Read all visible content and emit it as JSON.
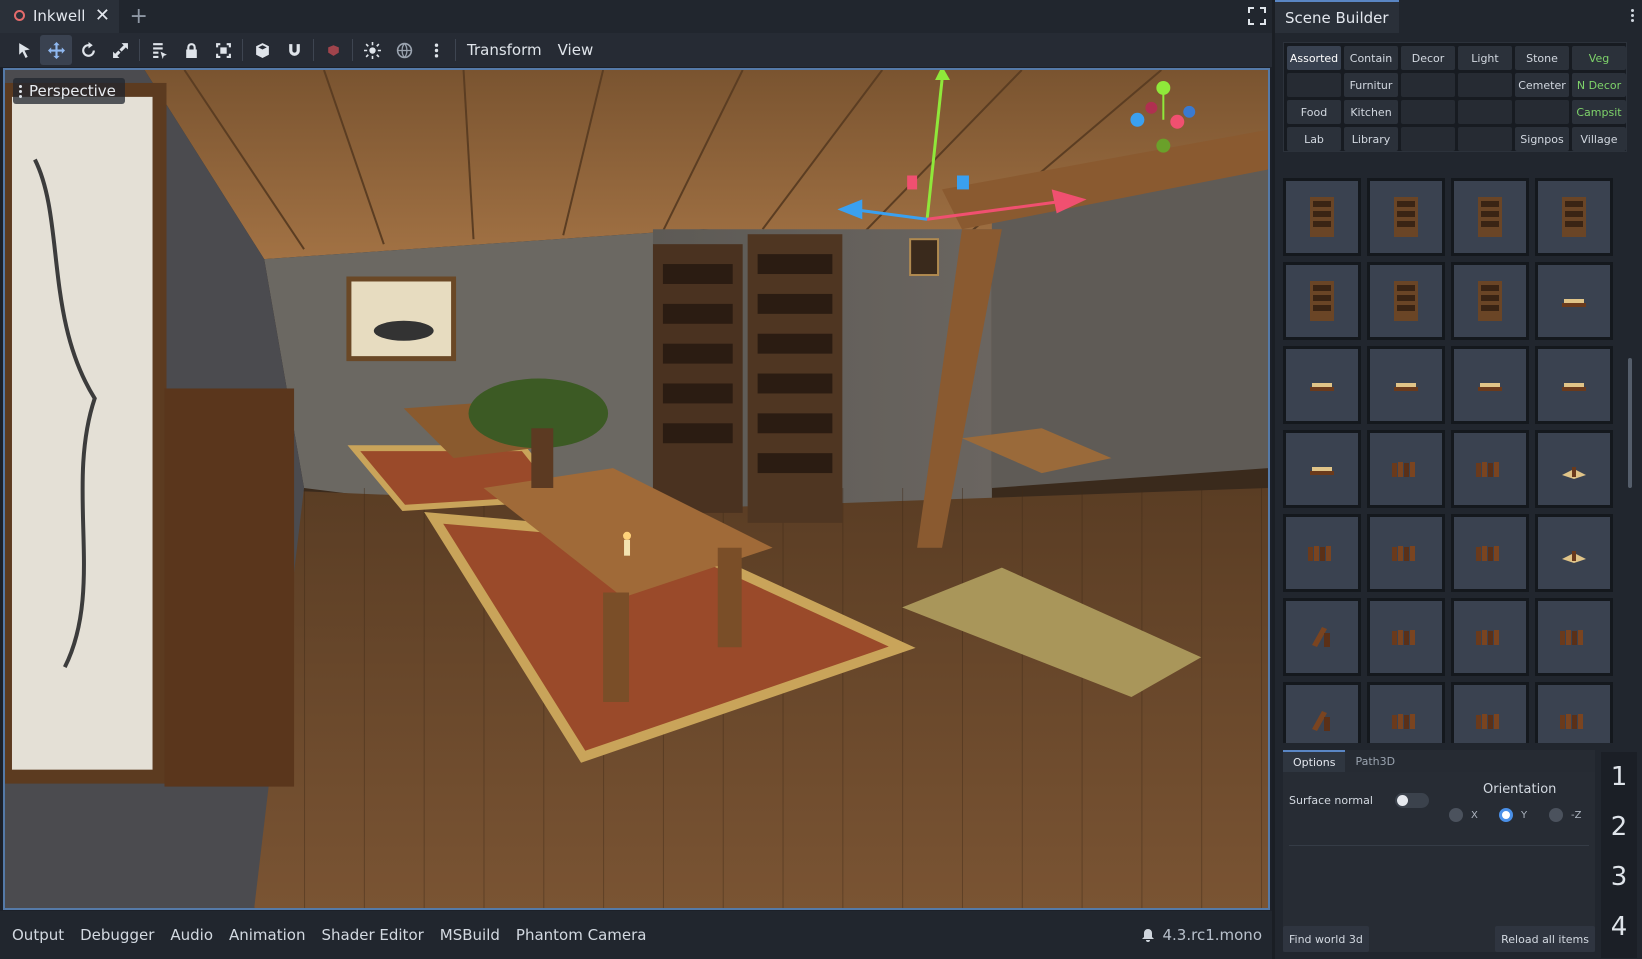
{
  "tab": {
    "title": "Inkwell",
    "close": "✕",
    "add": "+"
  },
  "toolbar": {
    "transform_label": "Transform",
    "view_label": "View"
  },
  "viewport": {
    "camera_label": "Perspective"
  },
  "bottom": {
    "items": [
      "Output",
      "Debugger",
      "Audio",
      "Animation",
      "Shader Editor",
      "MSBuild",
      "Phantom Camera"
    ],
    "version": "4.3.rc1.mono"
  },
  "dock": {
    "title": "Scene Builder",
    "categories": [
      {
        "label": "Assorted",
        "state": "selected"
      },
      {
        "label": "Contain",
        "state": ""
      },
      {
        "label": "Decor",
        "state": ""
      },
      {
        "label": "Light",
        "state": ""
      },
      {
        "label": "Stone",
        "state": ""
      },
      {
        "label": "Veg",
        "state": "green"
      },
      {
        "label": "",
        "state": "empty"
      },
      {
        "label": "Furnitur",
        "state": ""
      },
      {
        "label": "",
        "state": "empty"
      },
      {
        "label": "",
        "state": "empty"
      },
      {
        "label": "Cemeter",
        "state": ""
      },
      {
        "label": "N Decor",
        "state": "green"
      },
      {
        "label": "Food",
        "state": ""
      },
      {
        "label": "Kitchen",
        "state": ""
      },
      {
        "label": "",
        "state": "empty"
      },
      {
        "label": "",
        "state": "empty"
      },
      {
        "label": "",
        "state": "empty"
      },
      {
        "label": "Campsit",
        "state": "green"
      },
      {
        "label": "Lab",
        "state": ""
      },
      {
        "label": "Library",
        "state": ""
      },
      {
        "label": "",
        "state": "empty"
      },
      {
        "label": "",
        "state": "empty"
      },
      {
        "label": "Signpos",
        "state": ""
      },
      {
        "label": "Village",
        "state": ""
      }
    ],
    "assets": [
      "bookshelf",
      "bookshelf",
      "bookshelf",
      "bookshelf",
      "bookshelf",
      "bookshelf",
      "bookshelf",
      "book-flat",
      "book-flat",
      "book-flat",
      "book-flat",
      "book-flat",
      "book-flat",
      "book-row",
      "book-row",
      "book-open",
      "book-row",
      "book-row",
      "book-row",
      "book-open",
      "book-lean",
      "book-row",
      "book-row",
      "book-row",
      "book-lean",
      "book-row",
      "book-row",
      "book-row"
    ],
    "options": {
      "tabs": [
        "Options",
        "Path3D"
      ],
      "surface_normal_label": "Surface normal",
      "orientation_title": "Orientation",
      "orientation_options": [
        {
          "label": "X",
          "selected": false
        },
        {
          "label": "Y",
          "selected": true
        },
        {
          "label": "-Z",
          "selected": false
        }
      ],
      "find_label": "Find world 3d",
      "reload_label": "Reload all items"
    },
    "numbers": [
      "1",
      "2",
      "3",
      "4"
    ]
  },
  "colors": {
    "accent": "#4a90e8",
    "green": "#7ed36a",
    "tab_dot": "#e46b6b"
  }
}
